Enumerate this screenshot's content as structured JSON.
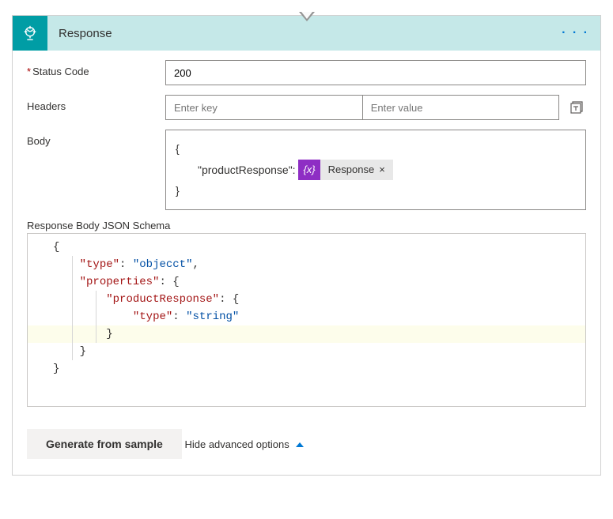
{
  "header": {
    "title": "Response",
    "menu": "· · ·"
  },
  "fields": {
    "statusCode": {
      "label": "Status Code",
      "value": "200",
      "required": true
    },
    "headers": {
      "label": "Headers",
      "keyPlaceholder": "Enter key",
      "valuePlaceholder": "Enter value"
    },
    "body": {
      "label": "Body",
      "open": "{",
      "propKey": "\"productResponse\":",
      "tokenFx": "{x}",
      "tokenName": "Response",
      "tokenClose": "×",
      "close": "}"
    },
    "schema": {
      "label": "Response Body JSON Schema",
      "lines": [
        {
          "t": "{"
        },
        {
          "t": "    \"type\": \"objecct\","
        },
        {
          "t": "    \"properties\": {"
        },
        {
          "t": "        \"productResponse\": {"
        },
        {
          "t": "            \"type\": \"string\""
        },
        {
          "t": "        }",
          "hl": true
        },
        {
          "t": "    }"
        },
        {
          "t": "}"
        }
      ]
    }
  },
  "actions": {
    "generate": "Generate from sample",
    "hideAdvanced": "Hide advanced options"
  }
}
